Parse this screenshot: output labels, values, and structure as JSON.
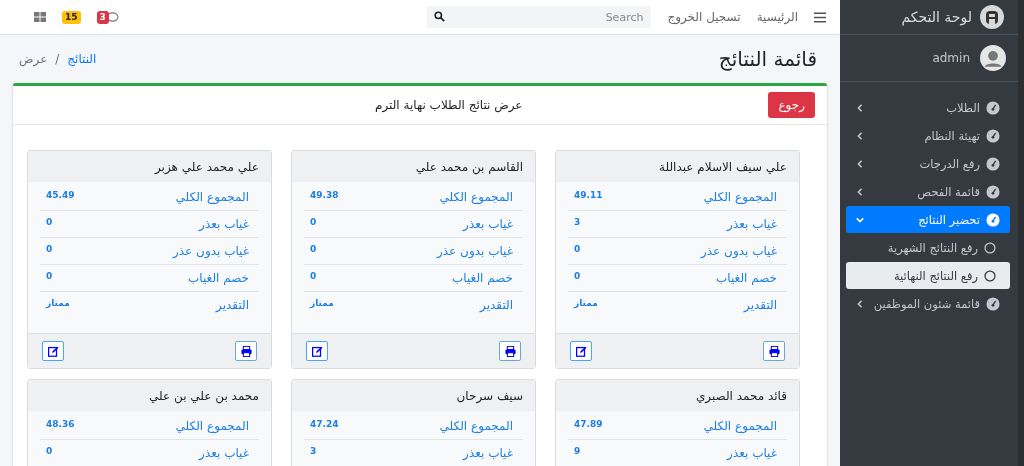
{
  "sidebar": {
    "brand": "لوحة التحكم",
    "user": "admin",
    "items": [
      {
        "label": "الطلاب",
        "selected": false,
        "expanded": false
      },
      {
        "label": "تهيئة النظام",
        "selected": false,
        "expanded": false
      },
      {
        "label": "رفع الدرجات",
        "selected": false,
        "expanded": false
      },
      {
        "label": "قائمة الفحص",
        "selected": false,
        "expanded": false
      },
      {
        "label": "تحضير النتائج",
        "selected": true,
        "expanded": true,
        "children": [
          {
            "label": "رفع النتائج الشهرية",
            "selected": false
          },
          {
            "label": "رفع النتائج النهائية",
            "selected": true
          }
        ]
      },
      {
        "label": "قائمة شئون الموظفين",
        "selected": false,
        "expanded": false
      }
    ]
  },
  "navbar": {
    "links": [
      "الرئيسية",
      "تسجيل الخروج"
    ],
    "search": {
      "placeholder": "Search"
    },
    "messages_badge": "3",
    "notifications_badge": "15"
  },
  "page": {
    "title": "قائمة النتائج",
    "breadcrumb": [
      {
        "label": "النتائج",
        "link": true
      },
      {
        "label": "عرض",
        "link": false
      }
    ],
    "breadcrumb_separator": "/"
  },
  "panel": {
    "back_button": "رجوع",
    "title": "عرض نتائج الطلاب نهاية الترم",
    "students": [
      {
        "name": "علي سيف الاسلام عبداللة",
        "rows": [
          {
            "label": "المجموع الكلي",
            "value": "49.11"
          },
          {
            "label": "غياب بعذر",
            "value": "3"
          },
          {
            "label": "غياب بدون عذر",
            "value": "0"
          },
          {
            "label": "خصم الغياب",
            "value": "0"
          },
          {
            "label": "التقدير",
            "value": "ممتاز"
          }
        ]
      },
      {
        "name": "القاسم بن محمد علي",
        "rows": [
          {
            "label": "المجموع الكلي",
            "value": "49.38"
          },
          {
            "label": "غياب بعذر",
            "value": "0"
          },
          {
            "label": "غياب بدون عذر",
            "value": "0"
          },
          {
            "label": "خصم الغياب",
            "value": "0"
          },
          {
            "label": "التقدير",
            "value": "ممتاز"
          }
        ]
      },
      {
        "name": "علي محمد علي هزبر",
        "rows": [
          {
            "label": "المجموع الكلي",
            "value": "45.49"
          },
          {
            "label": "غياب بعذر",
            "value": "0"
          },
          {
            "label": "غياب بدون عذر",
            "value": "0"
          },
          {
            "label": "خصم الغياب",
            "value": "0"
          },
          {
            "label": "التقدير",
            "value": "ممتاز"
          }
        ]
      },
      {
        "name": "قائد محمد الصبري",
        "rows": [
          {
            "label": "المجموع الكلي",
            "value": "47.89"
          },
          {
            "label": "غياب بعذر",
            "value": "9"
          }
        ]
      },
      {
        "name": "سيف سرحان",
        "rows": [
          {
            "label": "المجموع الكلي",
            "value": "47.24"
          },
          {
            "label": "غياب بعذر",
            "value": "3"
          }
        ]
      },
      {
        "name": "محمد بن علي بن علي",
        "rows": [
          {
            "label": "المجموع الكلي",
            "value": "48.36"
          },
          {
            "label": "غياب بعذر",
            "value": "0"
          }
        ]
      }
    ]
  }
}
